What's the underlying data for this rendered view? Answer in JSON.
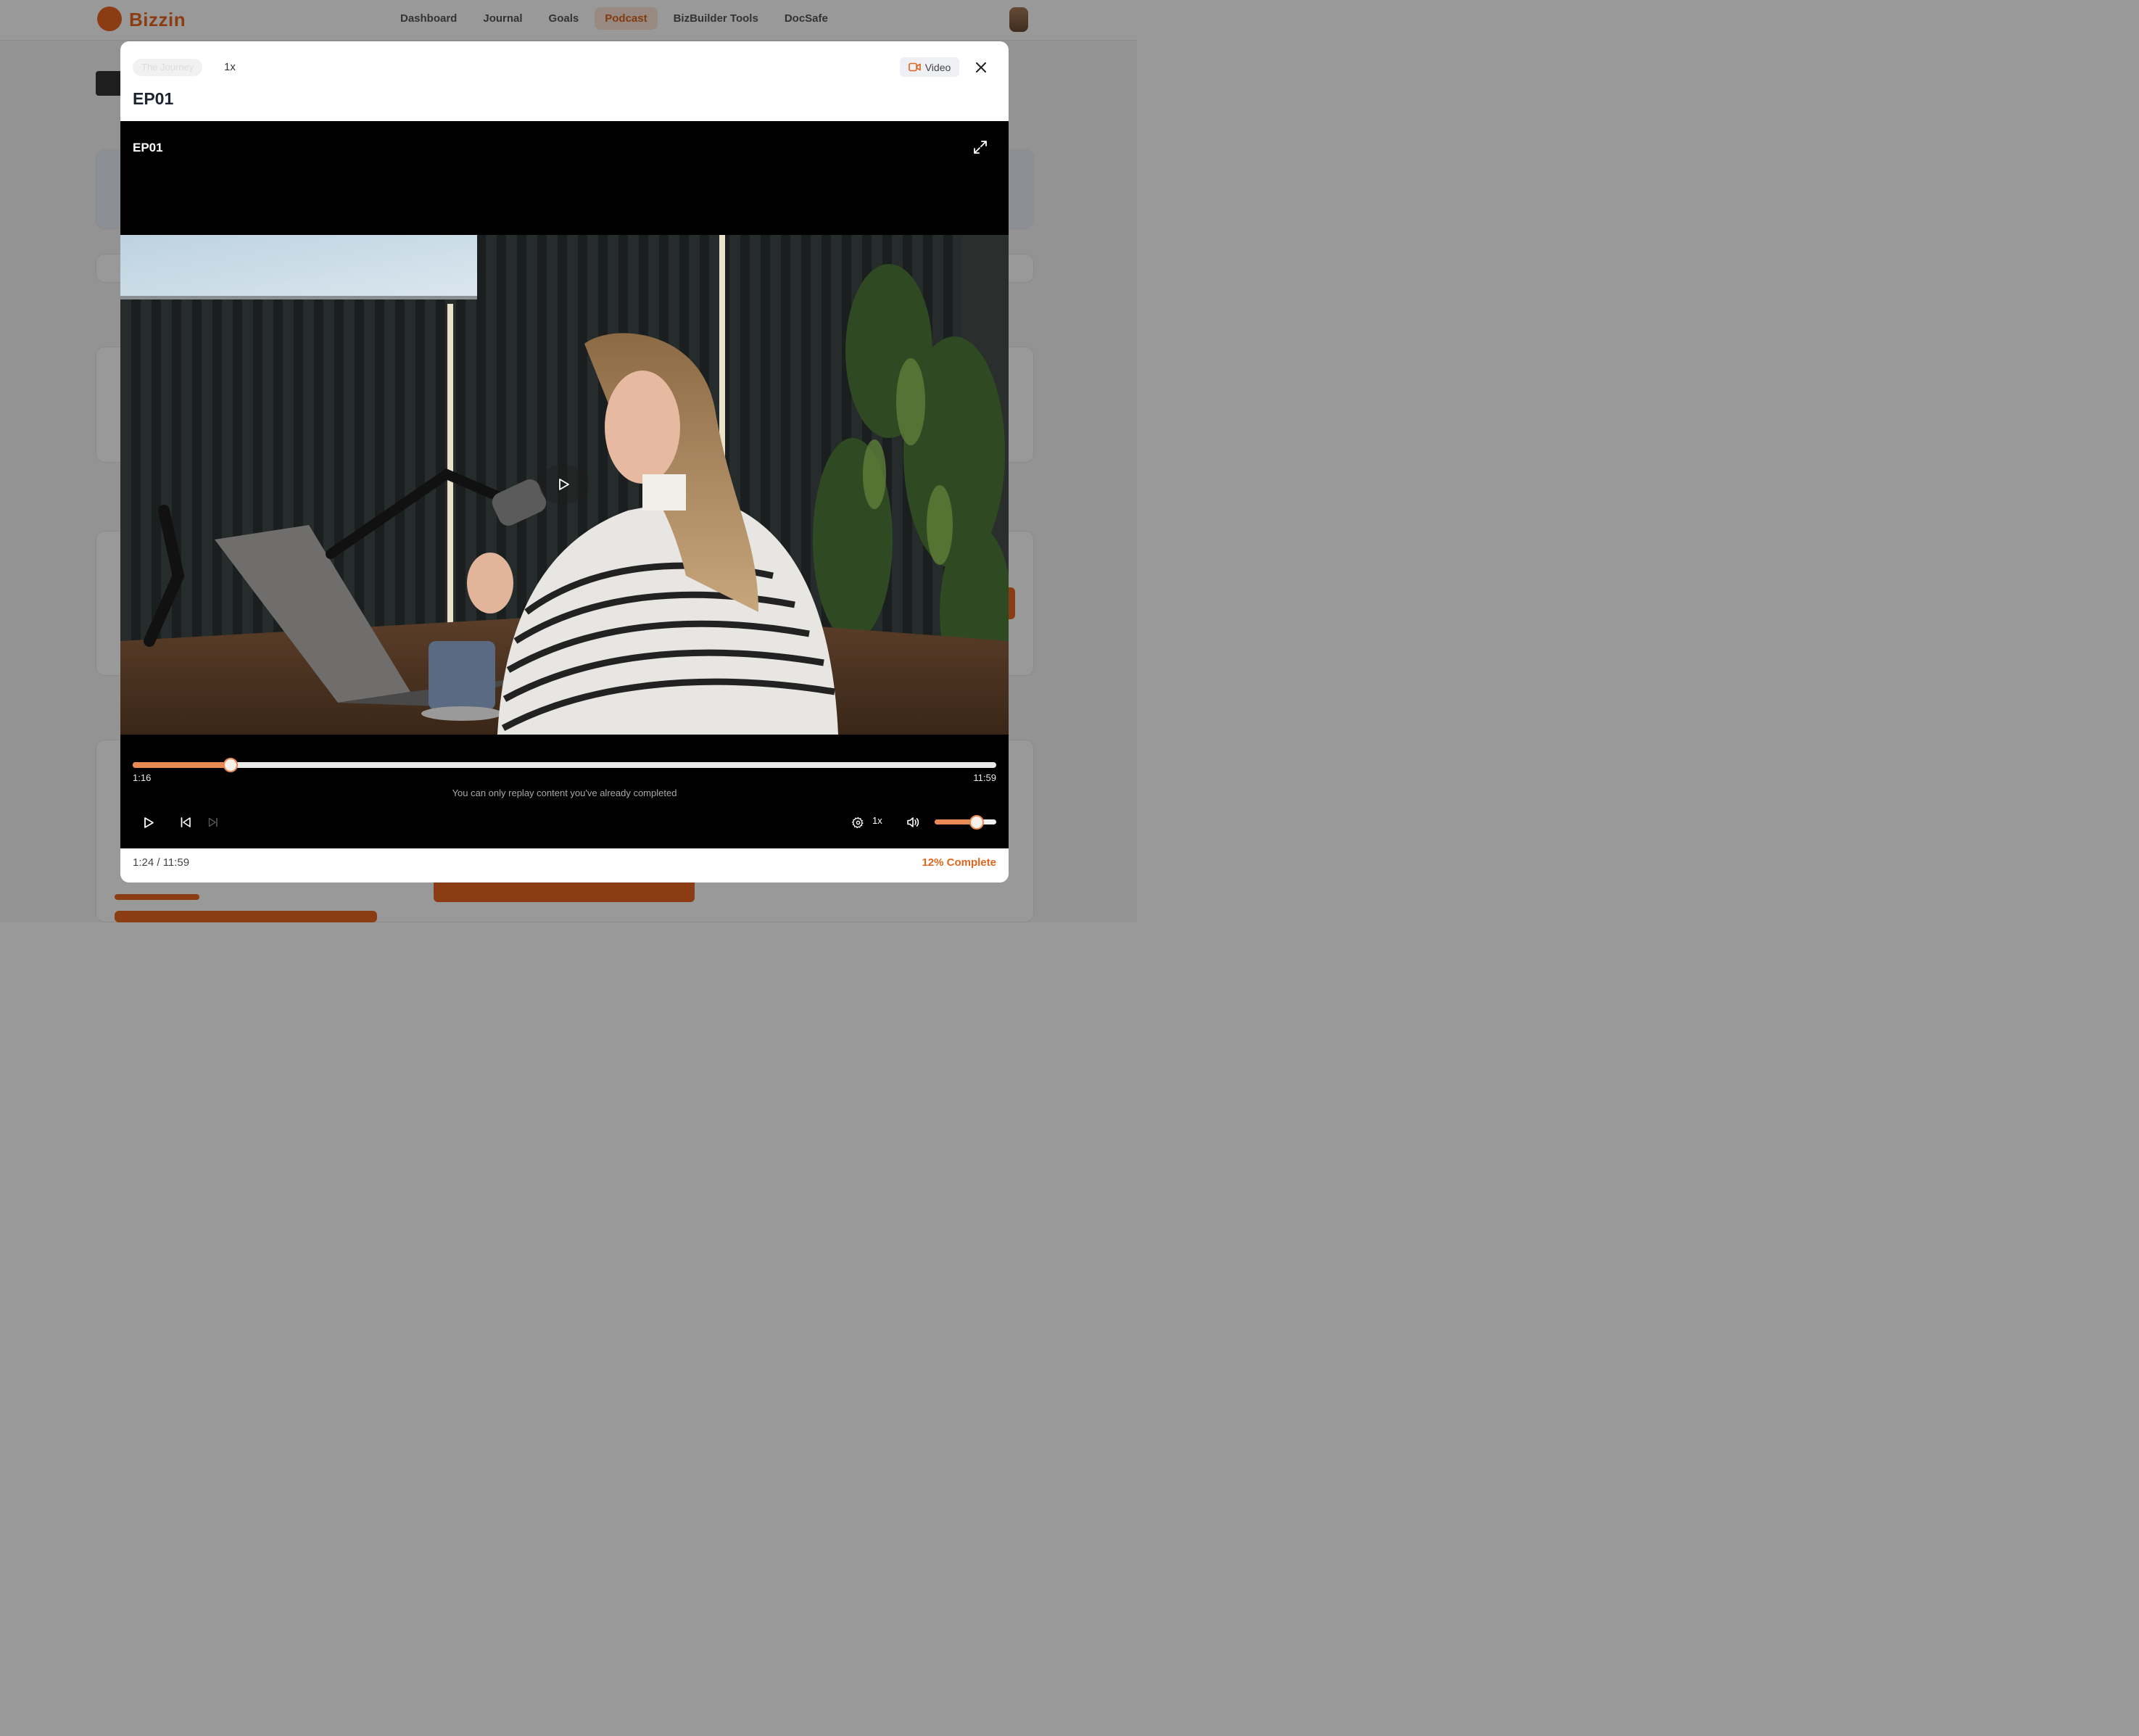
{
  "background": {
    "brand": "Bizzin",
    "nav": [
      "Dashboard",
      "Journal",
      "Goals",
      "Podcast",
      "BizBuilder Tools",
      "DocSafe"
    ],
    "active_nav": "Podcast"
  },
  "modal": {
    "series_chip": "The Journey",
    "speed_label": "1x",
    "video_badge": "Video",
    "title": "EP01"
  },
  "player": {
    "title": "EP01",
    "progress_fraction": 0.1133,
    "current_time": "1:16",
    "duration": "11:59",
    "notice": "You can only replay content you've already completed",
    "speed_label": "1x",
    "volume_fraction": 0.68
  },
  "footer": {
    "time_display": "1:24 / 11:59",
    "completion": "12% Complete"
  },
  "colors": {
    "accent": "#e98a55",
    "accent_text": "#e0651e"
  }
}
